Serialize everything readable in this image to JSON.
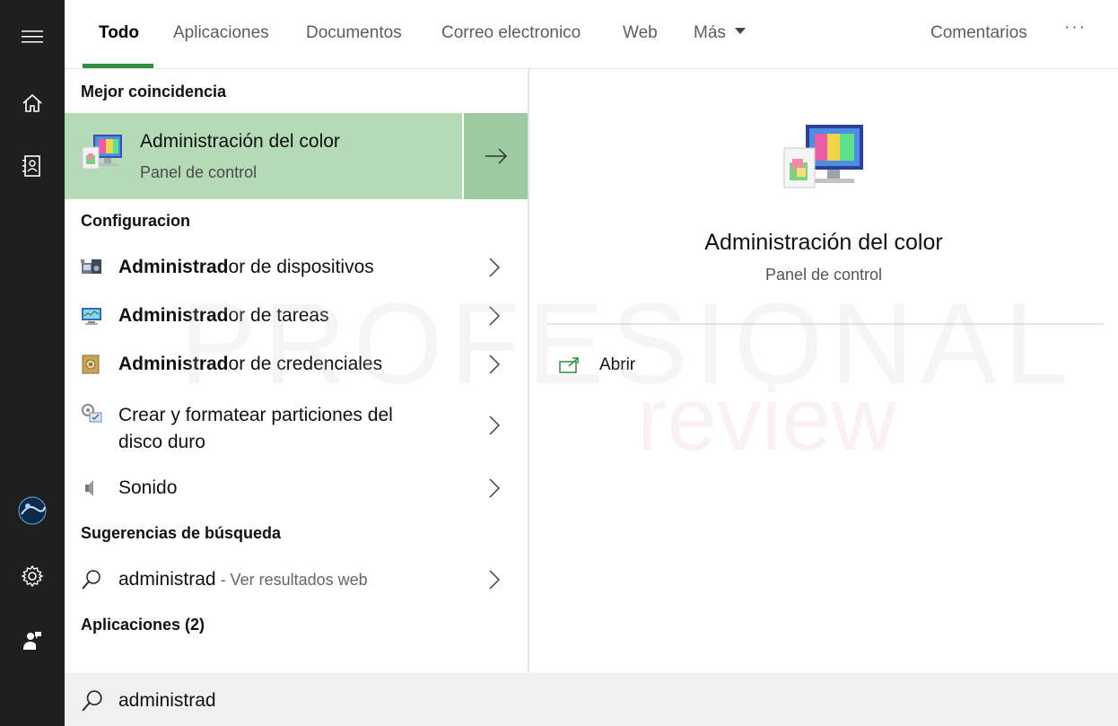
{
  "tabs": [
    {
      "label": "Todo"
    },
    {
      "label": "Aplicaciones"
    },
    {
      "label": "Documentos"
    },
    {
      "label": "Correo electronico"
    },
    {
      "label": "Web"
    },
    {
      "label": "Más"
    }
  ],
  "header": {
    "feedback": "Comentarios",
    "more_options": "···"
  },
  "sections": {
    "best_match": "Mejor coincidencia",
    "settings": "Configuracion",
    "suggestions": "Sugerencias de búsqueda",
    "apps": "Aplicaciones (2)"
  },
  "best_match": {
    "title": "Administración del color",
    "subtitle": "Panel de control"
  },
  "settings_items": [
    {
      "bold": "Administrad",
      "rest": "or de dispositivos",
      "icon": "device-manager-icon"
    },
    {
      "bold": "Administrad",
      "rest": "or de tareas",
      "icon": "task-manager-icon"
    },
    {
      "bold": "Administrad",
      "rest": "or de credenciales",
      "icon": "credential-manager-icon"
    },
    {
      "line1": "Crear y formatear particiones del",
      "line2": "disco duro",
      "icon": "disk-management-icon"
    },
    {
      "label": "Sonido",
      "icon": "speaker-icon"
    }
  ],
  "suggestion": {
    "query": "administrad",
    "hint": " - Ver resultados web"
  },
  "preview": {
    "title": "Administración del color",
    "subtitle": "Panel de control",
    "open": "Abrir"
  },
  "search": {
    "value": "administrad"
  },
  "watermark": {
    "line1": "PROFESIONAL",
    "line2": "review"
  },
  "colors": {
    "accent": "#2f8f3e",
    "selected_bg": "#b4dbb6",
    "sidebar": "#1f1f1f"
  }
}
